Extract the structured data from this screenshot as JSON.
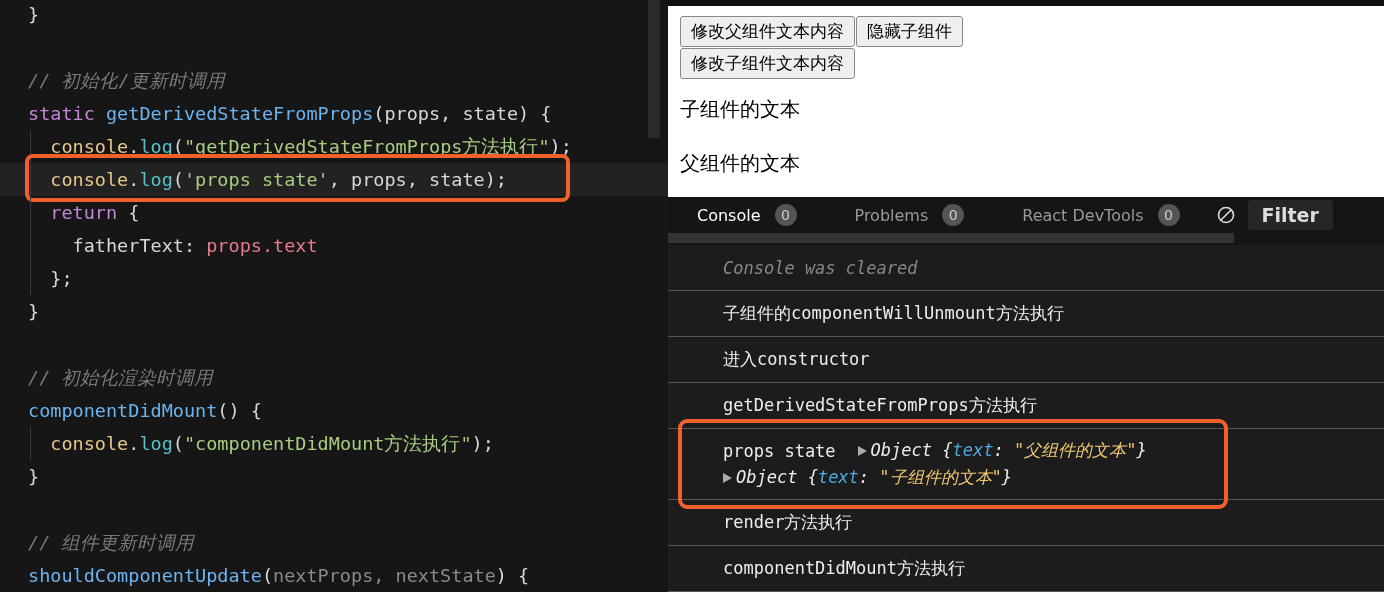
{
  "editor": {
    "lines": [
      {
        "highlighted": false,
        "tokens": [
          {
            "kind": "plain",
            "text": "}"
          }
        ]
      },
      {
        "highlighted": false
      },
      {
        "highlighted": false,
        "tokens": [
          {
            "kind": "comment",
            "text": "// 初始化/更新时调用"
          }
        ]
      },
      {
        "highlighted": false,
        "tokens": [
          {
            "kind": "keyword",
            "text": "static "
          },
          {
            "kind": "function",
            "text": "getDerivedStateFromProps"
          },
          {
            "kind": "plain",
            "text": "(props, state) {"
          }
        ]
      },
      {
        "highlighted": false,
        "tokens": [
          {
            "kind": "object",
            "text": "  console"
          },
          {
            "kind": "plain",
            "text": "."
          },
          {
            "kind": "method",
            "text": "log"
          },
          {
            "kind": "plain",
            "text": "("
          },
          {
            "kind": "string",
            "text": "\"getDerivedStateFromProps方法执行\""
          },
          {
            "kind": "plain",
            "text": ");"
          }
        ]
      },
      {
        "highlighted": true,
        "tokens": [
          {
            "kind": "object",
            "text": "  console"
          },
          {
            "kind": "plain",
            "text": "."
          },
          {
            "kind": "method",
            "text": "log"
          },
          {
            "kind": "plain",
            "text": "("
          },
          {
            "kind": "string",
            "text": "'props state'"
          },
          {
            "kind": "plain",
            "text": ", props, state);"
          }
        ]
      },
      {
        "highlighted": false,
        "tokens": [
          {
            "kind": "keyword",
            "text": "  return"
          },
          {
            "kind": "plain",
            "text": " {"
          }
        ]
      },
      {
        "highlighted": false,
        "tokens": [
          {
            "kind": "plain",
            "text": "    fatherText: "
          },
          {
            "kind": "member",
            "text": "props.text"
          }
        ]
      },
      {
        "highlighted": false,
        "tokens": [
          {
            "kind": "plain",
            "text": "  };"
          }
        ]
      },
      {
        "highlighted": false,
        "tokens": [
          {
            "kind": "plain",
            "text": "}"
          }
        ]
      },
      {
        "highlighted": false
      },
      {
        "highlighted": false,
        "tokens": [
          {
            "kind": "comment",
            "text": "// 初始化渲染时调用"
          }
        ]
      },
      {
        "highlighted": false,
        "tokens": [
          {
            "kind": "function",
            "text": "componentDidMount"
          },
          {
            "kind": "plain",
            "text": "() {"
          }
        ]
      },
      {
        "highlighted": false,
        "tokens": [
          {
            "kind": "object",
            "text": "  console"
          },
          {
            "kind": "plain",
            "text": "."
          },
          {
            "kind": "method",
            "text": "log"
          },
          {
            "kind": "plain",
            "text": "("
          },
          {
            "kind": "string",
            "text": "\"componentDidMount方法执行\""
          },
          {
            "kind": "plain",
            "text": ");"
          }
        ]
      },
      {
        "highlighted": false,
        "tokens": [
          {
            "kind": "plain",
            "text": "}"
          }
        ]
      },
      {
        "highlighted": false
      },
      {
        "highlighted": false,
        "tokens": [
          {
            "kind": "comment",
            "text": "// 组件更新时调用"
          }
        ]
      },
      {
        "highlighted": false,
        "tokens": [
          {
            "kind": "function",
            "text": "shouldComponentUpdate"
          },
          {
            "kind": "plain",
            "text": "("
          },
          {
            "kind": "param",
            "text": "nextProps, nextState"
          },
          {
            "kind": "plain",
            "text": ") {"
          }
        ]
      }
    ]
  },
  "preview": {
    "buttons": [
      "修改父组件文本内容",
      "隐藏子组件",
      "修改子组件文本内容"
    ],
    "texts": [
      "子组件的文本",
      "父组件的文本"
    ]
  },
  "devtools": {
    "tabs": [
      {
        "label": "Console",
        "count": "0",
        "selected": true
      },
      {
        "label": "Problems",
        "count": "0",
        "selected": false
      },
      {
        "label": "React DevTools",
        "count": "0",
        "selected": false
      }
    ],
    "filter": "Filter",
    "rows": [
      {
        "kind": "info",
        "highlighted": false,
        "text": "Console was cleared"
      },
      {
        "kind": "log",
        "highlighted": false,
        "text": "子组件的componentWillUnmount方法执行"
      },
      {
        "kind": "log",
        "highlighted": false,
        "text": "进入constructor"
      },
      {
        "kind": "log",
        "highlighted": false,
        "text": "getDerivedStateFromProps方法执行"
      },
      {
        "kind": "objects",
        "highlighted": true,
        "text": "props state",
        "objects": [
          [
            {
              "kind": "punct",
              "text": "Object {"
            },
            {
              "kind": "key",
              "text": "text"
            },
            {
              "kind": "punct",
              "text": ": "
            },
            {
              "kind": "value",
              "text": "\"父组件的文本\""
            },
            {
              "kind": "punct",
              "text": "}"
            }
          ],
          [
            {
              "kind": "punct",
              "text": "Object {"
            },
            {
              "kind": "key",
              "text": "text"
            },
            {
              "kind": "punct",
              "text": ": "
            },
            {
              "kind": "value",
              "text": "\"子组件的文本\""
            },
            {
              "kind": "punct",
              "text": "}"
            }
          ]
        ]
      },
      {
        "kind": "log",
        "highlighted": false,
        "text": "render方法执行"
      },
      {
        "kind": "log",
        "highlighted": false,
        "text": "componentDidMount方法执行"
      }
    ]
  }
}
